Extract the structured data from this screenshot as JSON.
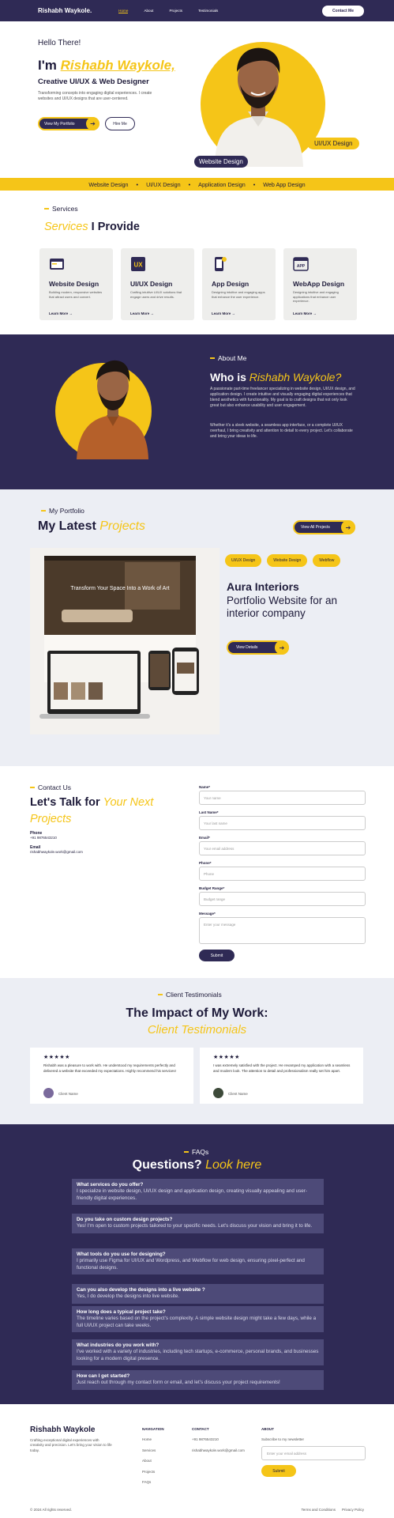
{
  "nav": {
    "brand": "Rishabh Waykole.",
    "links": [
      "Home",
      "About",
      "Projects",
      "Testimonials"
    ],
    "cta": "Contact Me"
  },
  "hero": {
    "greeting": "Hello There!",
    "im": "I'm",
    "name": "Rishabh Waykole,",
    "role": "Creative UI/UX & Web Designer",
    "desc": "Transforming concepts into engaging digital experiences. I create websites and UI/UX designs that are user-centered.",
    "btn_portfolio": "View My Portfolio",
    "btn_hire": "Hire Me",
    "tag_web": "Website Design",
    "tag_ui": "UI/UX Design"
  },
  "strip": [
    "Website Design",
    "UI/UX Design",
    "Application Design",
    "Web App Design"
  ],
  "services": {
    "label": "Services",
    "title_a": "Services",
    "title_b": "I Provide",
    "cards": [
      {
        "title": "Website Design",
        "desc": "Building modern, responsive websites that attract users and convert.",
        "link": "Learn More →"
      },
      {
        "title": "UI/UX Design",
        "desc": "Crafting intuitive UI/UX solutions that engage users and drive results.",
        "link": "Learn More →"
      },
      {
        "title": "App Design",
        "desc": "Designing intuitive and engaging apps that enhance the user experience.",
        "link": "Learn More →"
      },
      {
        "title": "WebApp Design",
        "desc": "Designing intuitive and engaging applications that enhance user experience.",
        "link": "Learn More →"
      }
    ]
  },
  "about": {
    "label": "About Me",
    "title_a": "Who is",
    "title_b": "Rishabh Waykole?",
    "p1": "A passionate part-time freelancer specializing in website design, UI/UX design, and application design. I create intuitive and visually engaging digital experiences that blend aesthetics with functionality. My goal is to craft designs that not only look great but also enhance usability and user engagement.",
    "p2": "Whether it's a sleek website, a seamless app interface, or a complete UI/UX overhaul, I bring creativity and attention to detail to every project. Let's collaborate and bring your ideas to life."
  },
  "portfolio": {
    "label": "My Portfolio",
    "title_a": "My Latest",
    "title_b": "Projects",
    "view_all": "View All Projects",
    "chips": [
      "UI/UX Design",
      "Website Design",
      "Webflow"
    ],
    "project_title": "Aura Interiors",
    "project_sub": "Portfolio Website for an interior company",
    "view_details": "View Details",
    "mock_heading": "Transform Your Space Into a Work of Art"
  },
  "contact": {
    "label": "Contact Us",
    "title_a": "Let's Talk for",
    "title_b": "Your Next Projects",
    "phone_label": "Phone",
    "phone": "+91 9876543210",
    "email_label": "Email",
    "email": "rishabhwaykole.work@gmail.com",
    "fields": [
      {
        "label": "Name*",
        "placeholder": "Your name"
      },
      {
        "label": "Last Name*",
        "placeholder": "Your last name"
      },
      {
        "label": "Email*",
        "placeholder": "Your email address"
      },
      {
        "label": "Phone*",
        "placeholder": "Phone"
      },
      {
        "label": "Budget Range*",
        "placeholder": "Budget range"
      }
    ],
    "message_label": "Message*",
    "message_placeholder": "Enter your message",
    "submit": "Submit"
  },
  "testimonials": {
    "label": "Client Testimonials",
    "title": "The Impact of My Work:",
    "subtitle": "Client Testimonials",
    "items": [
      {
        "stars": "★★★★★",
        "text": "Rishabh was a pleasure to work with. He understood my requirements perfectly and delivered a website that exceeded my expectations. Highly recommend his services!",
        "name": "Client Name"
      },
      {
        "stars": "★★★★★",
        "text": "I was extremely satisfied with the project. He revamped my application with a seamless and modern look. The attention to detail and professionalism really set him apart.",
        "name": "Client Name"
      }
    ]
  },
  "faq": {
    "label": "FAQs",
    "title_a": "Questions?",
    "title_b": "Look here",
    "items": [
      {
        "q": "What services do you offer?",
        "a": "I specialize in website design, UI/UX design and application design, creating visually appealing and user-friendly digital experiences."
      },
      {
        "q": "Do you take on custom design projects?",
        "a": "Yes! I'm open to custom projects tailored to your specific needs. Let's discuss your vision and bring it to life."
      },
      {
        "q": "What tools do you use for designing?",
        "a": "I primarily use Figma for UI/UX and Wordpress, and Webflow for web design, ensuring pixel-perfect and functional designs."
      },
      {
        "q": "Can you also develop the designs into a live website ?",
        "a": "Yes, I do develop the designs into live website."
      },
      {
        "q": "How long does a typical project take?",
        "a": "The timeline varies based on the project's complexity. A simple website design might take a few days, while a full UI/UX project can take weeks."
      },
      {
        "q": "What industries do you work with?",
        "a": "I've worked with a variety of industries, including tech startups, e-commerce, personal brands, and businesses looking for a modern digital presence."
      },
      {
        "q": "How can I get started?",
        "a": "Just reach out through my contact form or email, and let's discuss your project requirements!"
      }
    ]
  },
  "footer": {
    "brand": "Rishabh Waykole",
    "desc": "Crafting exceptional digital experiences with creativity and precision. Let's bring your vision to life today.",
    "navigation_title": "NAVIGATION",
    "navigation": [
      "Home",
      "Services",
      "About",
      "Projects",
      "FAQs"
    ],
    "contact_title": "CONTACT",
    "contact": [
      "+91 9876543210",
      "rishabhwaykole.work@gmail.com"
    ],
    "about_title": "ABOUT",
    "newsletter_label": "Subscribe to my newsletter",
    "newsletter_placeholder": "Enter your email address",
    "subscribe": "Submit",
    "copyright": "© 2024 All rights reserved.",
    "legal": [
      "Terms and Conditions",
      "Privacy Policy"
    ]
  },
  "colors": {
    "navy": "#2f2a55",
    "yellow": "#f5c518",
    "light": "#eceef4"
  }
}
